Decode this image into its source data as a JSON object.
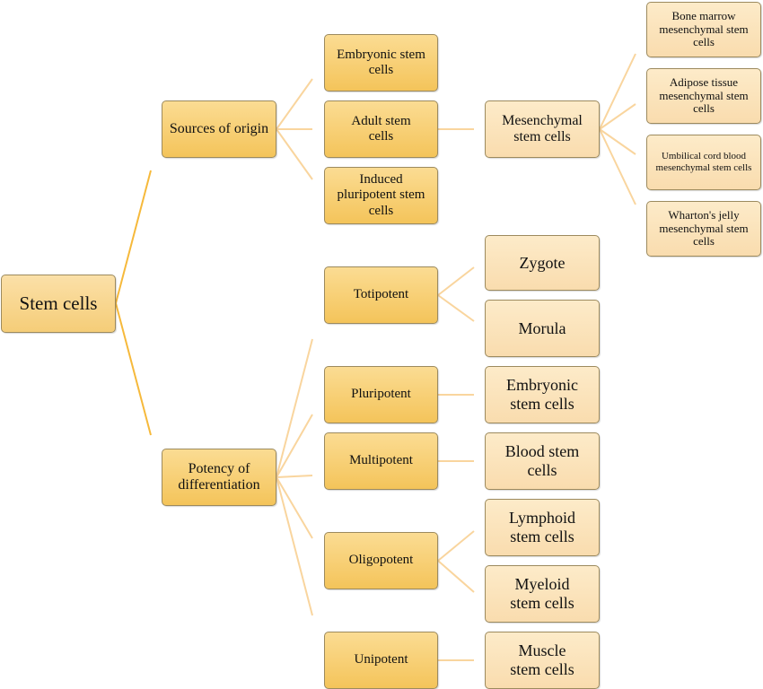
{
  "colors": {
    "line_major": "#f6b93b",
    "line_minor": "#f9d59e",
    "box_dark": "#f4c45a",
    "box_light": "#fbe3bc"
  },
  "root": "Stem cells",
  "sources": {
    "label": "Sources of origin",
    "children": [
      "Embryonic stem cells",
      "Adult stem cells",
      "Induced pluripotent stem cells"
    ]
  },
  "mesenchymal": {
    "label": "Mesenchymal stem cells",
    "children": [
      "Bone marrow mesenchymal stem cells",
      "Adipose tissue mesenchymal stem cells",
      "Umbilical cord blood mesenchymal stem cells",
      "Wharton's jelly mesenchymal stem cells"
    ]
  },
  "potency": {
    "label": "Potency of differentiation",
    "children": [
      "Totipotent",
      "Pluripotent",
      "Multipotent",
      "Oligopotent",
      "Unipotent"
    ]
  },
  "examples": [
    "Zygote",
    "Morula",
    "Embryonic stem cells",
    "Blood stem cells",
    "Lymphoid stem cells",
    "Myeloid stem cells",
    "Muscle stem cells"
  ]
}
